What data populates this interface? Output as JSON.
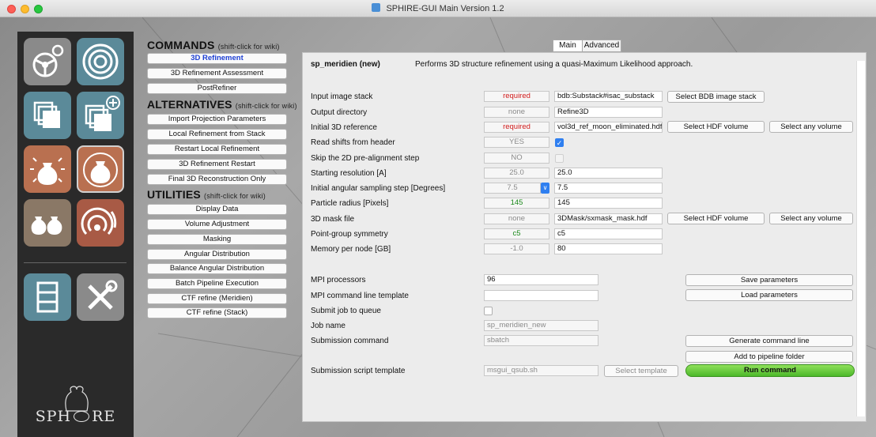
{
  "window": {
    "title": "SPHIRE-GUI Main Version 1.2"
  },
  "logo": {
    "text_left": "SPH",
    "text_right": "RE"
  },
  "sidebar": {
    "icons": [
      {
        "name": "gear-steering-icon",
        "color": "#8a8a8a"
      },
      {
        "name": "target-rings-icon",
        "color": "#5b8a99"
      },
      {
        "name": "stack-icon",
        "color": "#5b8a99"
      },
      {
        "name": "stack-add-icon",
        "color": "#5b8a99"
      },
      {
        "name": "bag-rays-icon",
        "color": "#b97050"
      },
      {
        "name": "bag-refine-icon",
        "color": "#b97050"
      },
      {
        "name": "two-bags-icon",
        "color": "#8a7866"
      },
      {
        "name": "signal-waves-icon",
        "color": "#a85a45"
      },
      {
        "name": "film-strip-icon",
        "color": "#5b8a99"
      },
      {
        "name": "tools-icon",
        "color": "#8a8a8a"
      }
    ]
  },
  "commands": {
    "title": "COMMANDS",
    "hint": "(shift-click for wiki)",
    "items": [
      "3D Refinement",
      "3D Refinement Assessment",
      "PostRefiner"
    ]
  },
  "alternatives": {
    "title": "ALTERNATIVES",
    "hint": "(shift-click for wiki)",
    "items": [
      "Import Projection Parameters",
      "Local Refinement from Stack",
      "Restart Local Refinement",
      "3D Refinement Restart",
      "Final 3D Reconstruction Only"
    ]
  },
  "utilities": {
    "title": "UTILITIES",
    "hint": "(shift-click for wiki)",
    "items": [
      "Display Data",
      "Volume Adjustment",
      "Masking",
      "Angular Distribution",
      "Balance Angular Distribution",
      "Batch Pipeline Execution",
      "CTF refine (Meridien)",
      "CTF refine (Stack)"
    ]
  },
  "tabs": [
    "Main",
    "Advanced"
  ],
  "header": {
    "program": "sp_meridien (new)",
    "description": "Performs 3D structure refinement using a quasi-Maximum Likelihood approach."
  },
  "params": [
    {
      "label": "Input image stack",
      "default": "required",
      "value": "bdb:Substack#isac_substack",
      "btn1": "Select BDB image stack"
    },
    {
      "label": "Output directory",
      "default": "none",
      "value": "Refine3D"
    },
    {
      "label": "Initial 3D reference",
      "default": "required",
      "value": "vol3d_ref_moon_eliminated.hdf",
      "btn1": "Select HDF volume",
      "btn2": "Select any volume"
    },
    {
      "label": "Read shifts from header",
      "default": "YES",
      "checked": "✓"
    },
    {
      "label": "Skip the 2D pre-alignment step",
      "default": "NO"
    },
    {
      "label": "Starting resolution [A]",
      "default": "25.0",
      "value": "25.0"
    },
    {
      "label": "Initial angular sampling step [Degrees]",
      "default": "7.5",
      "value": "7.5"
    },
    {
      "label": "Particle radius [Pixels]",
      "default": "145",
      "value": "145"
    },
    {
      "label": "3D mask file",
      "default": "none",
      "value": "3DMask/sxmask_mask.hdf",
      "btn1": "Select HDF volume",
      "btn2": "Select any volume"
    },
    {
      "label": "Point-group symmetry",
      "default": "c5",
      "value": "c5"
    },
    {
      "label": "Memory per node [GB]",
      "default": "-1.0",
      "value": "80"
    }
  ],
  "submission": {
    "mpi_label": "MPI processors",
    "mpi_value": "96",
    "mpi_template_label": "MPI command line template",
    "mpi_template_value": "",
    "queue_label": "Submit job to queue",
    "jobname_label": "Job name",
    "jobname_value": "sp_meridien_new",
    "subcmd_label": "Submission command",
    "subcmd_value": "sbatch",
    "script_label": "Submission script template",
    "script_value": "msgui_qsub.sh",
    "select_template": "Select template"
  },
  "actions": {
    "save": "Save parameters",
    "load": "Load parameters",
    "generate": "Generate command line",
    "pipeline": "Add to pipeline folder",
    "run": "Run command"
  },
  "spin_icon": "chevron-down-icon",
  "colors": {
    "active_command": "#1d3fd4",
    "required": "#d11b1b",
    "default_green": "#1c8a1c",
    "run_button": "#4cb82a"
  }
}
